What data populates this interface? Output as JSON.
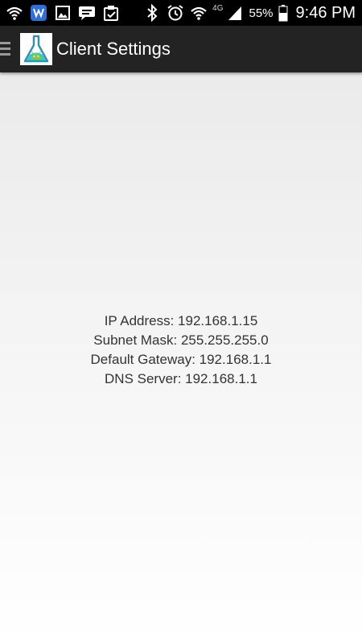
{
  "status_bar": {
    "icons_left": [
      "wifi-signal-icon",
      "shield-app-icon",
      "gallery-icon",
      "chat-bubble-icon",
      "clipboard-check-icon"
    ],
    "icons_right": [
      "bluetooth-icon",
      "alarm-clock-icon",
      "wifi-icon",
      "cell-signal-icon",
      "battery-icon"
    ],
    "network_type": "4G",
    "battery_percent": "55%",
    "time": "9:46 PM"
  },
  "action_bar": {
    "title": "Client Settings",
    "logo_icon": "flask-android-icon",
    "menu_icon": "hamburger-icon",
    "background_color": "#232323"
  },
  "network_info": {
    "ip_address": "IP Address: 192.168.1.15",
    "subnet_mask": "Subnet Mask: 255.255.255.0",
    "default_gateway": "Default Gateway: 192.168.1.1",
    "dns_server": "DNS Server: 192.168.1.1"
  }
}
